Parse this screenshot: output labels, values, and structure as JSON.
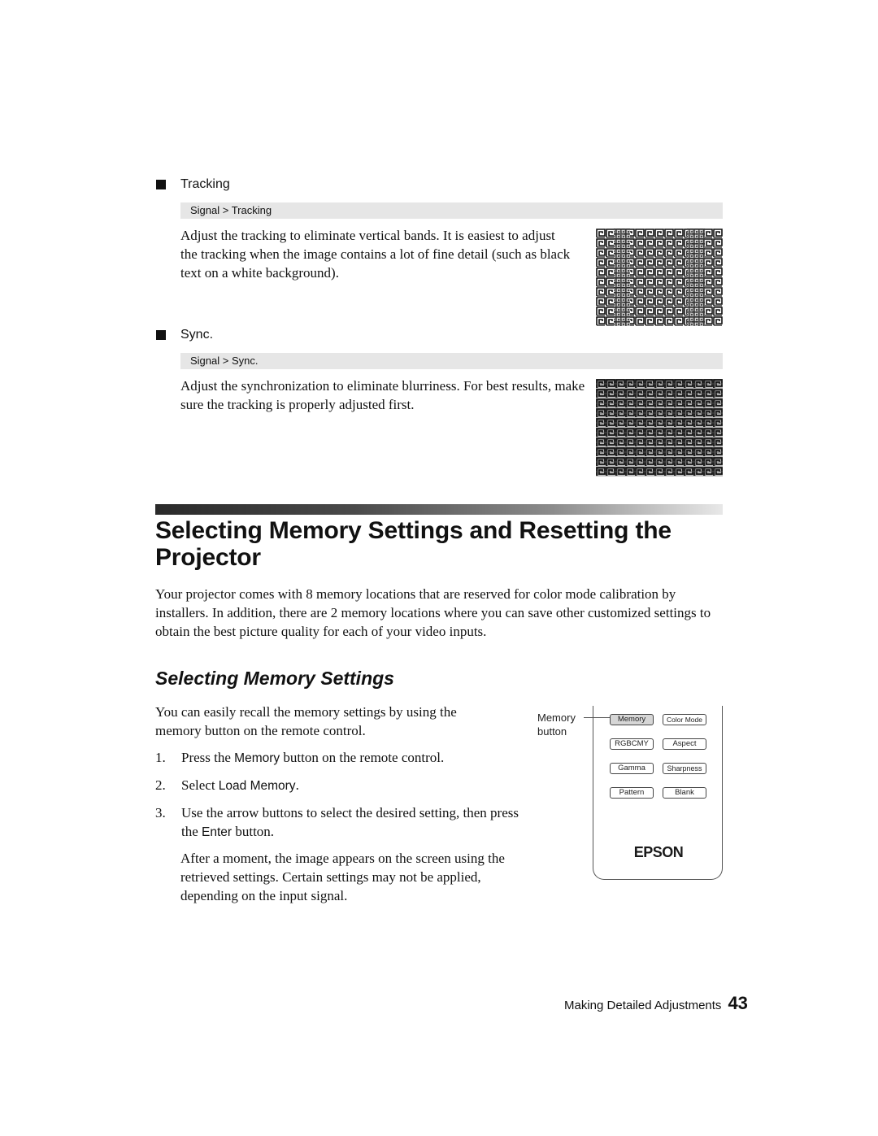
{
  "sections": {
    "tracking": {
      "heading": "Tracking",
      "menu_path": "Signal > Tracking",
      "body": "Adjust the tracking to eliminate vertical bands. It is easiest to adjust the tracking when the image contains a lot of fine detail (such as black text on a white background).",
      "image_alt": "tracking-pattern-image"
    },
    "sync": {
      "heading": "Sync.",
      "menu_path": "Signal > Sync.",
      "body": "Adjust the synchronization to eliminate blurriness. For best results, make sure the tracking is properly adjusted first.",
      "image_alt": "sync-pattern-image"
    }
  },
  "main_heading": "Selecting Memory Settings and Resetting the Projector",
  "intro": "Your projector comes with 8 memory locations that are reserved for color mode calibration by installers. In addition, there are 2 memory locations where you can save other customized settings to obtain the best picture quality for each of your video inputs.",
  "sub_heading": "Selecting Memory Settings",
  "sub_intro": "You can easily recall the memory settings by using the memory button on the remote control.",
  "steps": [
    {
      "num": "1.",
      "pre": "Press the ",
      "ui": "Memory",
      "post": " button on the remote control."
    },
    {
      "num": "2.",
      "pre": "Select ",
      "ui": "Load Memory",
      "post": "."
    },
    {
      "num": "3.",
      "pre": "Use the arrow buttons to select the desired setting, then press the ",
      "ui": "Enter",
      "post": " button."
    }
  ],
  "after_note": "After a moment, the image appears on the screen using the retrieved settings. Certain settings may not be applied, depending on the input signal.",
  "remote": {
    "callout_line1": "Memory",
    "callout_line2": "button",
    "buttons": [
      "Memory",
      "Color Mode",
      "RGBCMY",
      "Aspect",
      "Gamma",
      "Sharpness",
      "Pattern",
      "Blank"
    ],
    "brand": "EPSON"
  },
  "footer": {
    "chapter": "Making Detailed Adjustments",
    "page_number": "43"
  }
}
